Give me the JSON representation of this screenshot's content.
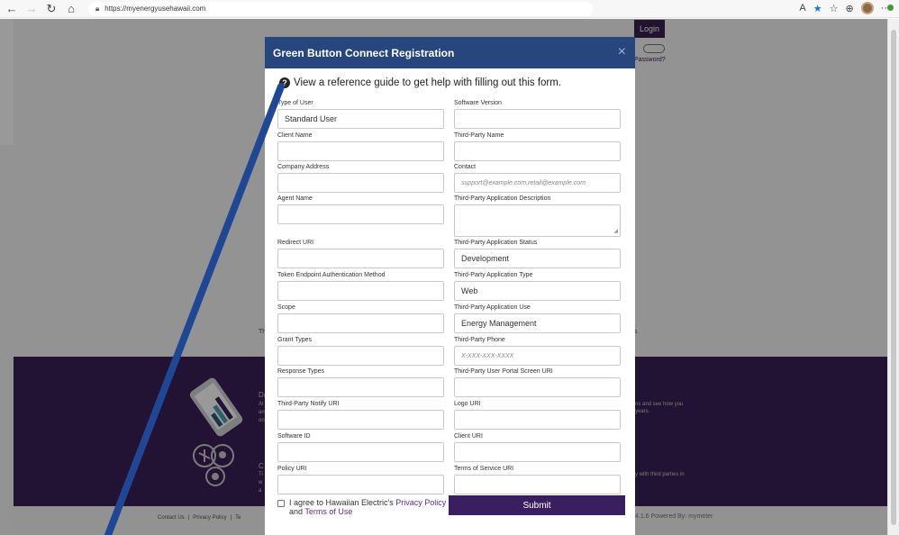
{
  "browser": {
    "url": "https://myenergyusehawaii.com",
    "icons": [
      "back-arrow-icon",
      "forward-arrow-icon",
      "refresh-icon",
      "home-icon",
      "lock-icon",
      "read-aloud-icon",
      "favorite-star-icon",
      "favorites-icon",
      "collections-icon",
      "profile-avatar",
      "extensions-icon"
    ]
  },
  "background": {
    "login_label": "Login",
    "password_link": "Password?",
    "left_text": "Th",
    "right_text": "ts",
    "purple_texts": [
      "Da",
      "Al",
      "an",
      "on",
      "ns and see how you",
      "years.",
      "C",
      "Ti",
      "w",
      "a",
      "y with third parties in"
    ],
    "footer_links": [
      "Contact Us",
      "Privacy Policy",
      "Te"
    ],
    "powered_by": "4.1.6 Powered By: mymeter"
  },
  "modal": {
    "title": "Green Button Connect Registration",
    "close_label": "×",
    "guide_text": "View a reference guide to get help with filling out this form.",
    "left_fields": [
      {
        "label": "Type of User",
        "value": "Standard User",
        "placeholder": ""
      },
      {
        "label": "Client Name",
        "value": "",
        "placeholder": ""
      },
      {
        "label": "Company Address",
        "value": "",
        "placeholder": ""
      },
      {
        "label": "Agent Name",
        "value": "",
        "placeholder": ""
      },
      {
        "label": "Redirect URI",
        "value": "",
        "placeholder": ""
      },
      {
        "label": "Token Endpoint Authentication Method",
        "value": "",
        "placeholder": ""
      },
      {
        "label": "Scope",
        "value": "",
        "placeholder": ""
      },
      {
        "label": "Grant Types",
        "value": "",
        "placeholder": ""
      },
      {
        "label": "Response Types",
        "value": "",
        "placeholder": ""
      },
      {
        "label": "Third-Party Notify URI",
        "value": "",
        "placeholder": ""
      },
      {
        "label": "Software ID",
        "value": "",
        "placeholder": ""
      },
      {
        "label": "Policy URI",
        "value": "",
        "placeholder": ""
      }
    ],
    "right_fields": [
      {
        "label": "Software Version",
        "value": "",
        "placeholder": ""
      },
      {
        "label": "Third-Party Name",
        "value": "",
        "placeholder": ""
      },
      {
        "label": "Contact",
        "value": "",
        "placeholder": "support@example.com,retail@example.com"
      },
      {
        "label": "Third-Party Application Description",
        "value": "",
        "placeholder": ""
      },
      {
        "label": "Third-Party Application Status",
        "value": "Development",
        "placeholder": ""
      },
      {
        "label": "Third-Party Application Type",
        "value": "Web",
        "placeholder": ""
      },
      {
        "label": "Third-Party Application Use",
        "value": "Energy Management",
        "placeholder": ""
      },
      {
        "label": "Third-Party Phone",
        "value": "",
        "placeholder": "X-XXX-XXX-XXXX"
      },
      {
        "label": "Third-Party User Portal Screen URI",
        "value": "",
        "placeholder": ""
      },
      {
        "label": "Logo URI",
        "value": "",
        "placeholder": ""
      },
      {
        "label": "Client URI",
        "value": "",
        "placeholder": ""
      },
      {
        "label": "Terms of Service URI",
        "value": "",
        "placeholder": ""
      }
    ],
    "agree_prefix": "I agree to Hawaiian Electric's",
    "privacy_link": "Privacy Policy",
    "and_text": "and",
    "terms_link": "Terms of Use",
    "submit_label": "Submit"
  },
  "colors": {
    "header_blue": "#27467e",
    "purple": "#3a1f55",
    "annotation_line": "#1f4796"
  }
}
